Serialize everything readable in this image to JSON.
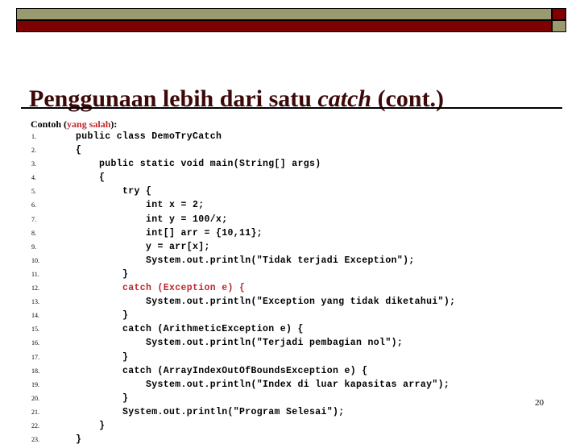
{
  "slide": {
    "title_prefix": "Penggunaan lebih dari satu ",
    "title_italic": "catch",
    "title_suffix": " (cont.)",
    "page_number": "20"
  },
  "banner": {
    "olive_color": "#9a9a6e",
    "red_color": "#7e0000",
    "outline_color": "#000000"
  },
  "caption": {
    "black_prefix": "Contoh (",
    "red_text": "yang salah",
    "black_suffix": "):"
  },
  "code": {
    "accent_color": "#c0272d",
    "lines": [
      {
        "n": "1.",
        "text": "    public class DemoTryCatch",
        "color": "black"
      },
      {
        "n": "2.",
        "text": "    {",
        "color": "black"
      },
      {
        "n": "3.",
        "text": "        public static void main(String[] args)",
        "color": "black"
      },
      {
        "n": "4.",
        "text": "        {",
        "color": "black"
      },
      {
        "n": "5.",
        "text": "            try {",
        "color": "black"
      },
      {
        "n": "6.",
        "text": "                int x = 2;",
        "color": "black"
      },
      {
        "n": "7.",
        "text": "                int y = 100/x;",
        "color": "black"
      },
      {
        "n": "8.",
        "text": "                int[] arr = {10,11};",
        "color": "black"
      },
      {
        "n": "9.",
        "text": "                y = arr[x];",
        "color": "black"
      },
      {
        "n": "10.",
        "text": "                System.out.println(\"Tidak terjadi Exception\");",
        "color": "black"
      },
      {
        "n": "11.",
        "text": "            }",
        "color": "black"
      },
      {
        "n": "12.",
        "text": "            catch (Exception e) {",
        "color": "red"
      },
      {
        "n": "13.",
        "text": "                System.out.println(\"Exception yang tidak diketahui\");",
        "color": "black"
      },
      {
        "n": "14.",
        "text": "            }",
        "color": "black"
      },
      {
        "n": "15.",
        "text": "            catch (ArithmeticException e) {",
        "color": "black"
      },
      {
        "n": "16.",
        "text": "                System.out.println(\"Terjadi pembagian nol\");",
        "color": "black"
      },
      {
        "n": "17.",
        "text": "            }",
        "color": "black"
      },
      {
        "n": "18.",
        "text": "            catch (ArrayIndexOutOfBoundsException e) {",
        "color": "black"
      },
      {
        "n": "19.",
        "text": "                System.out.println(\"Index di luar kapasitas array\");",
        "color": "black"
      },
      {
        "n": "20.",
        "text": "            }",
        "color": "black"
      },
      {
        "n": "21.",
        "text": "            System.out.println(\"Program Selesai\");",
        "color": "black"
      },
      {
        "n": "22.",
        "text": "        }",
        "color": "black"
      },
      {
        "n": "23.",
        "text": "    }",
        "color": "black"
      }
    ]
  }
}
